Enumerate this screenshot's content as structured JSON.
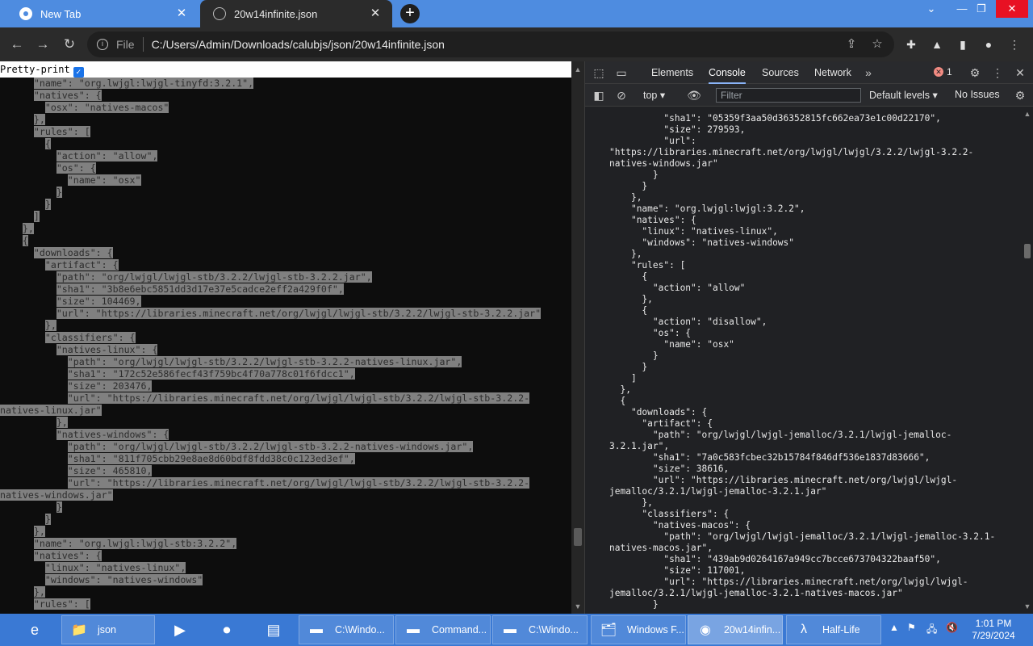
{
  "browser": {
    "tabs": [
      {
        "title": "New Tab"
      },
      {
        "title": "20w14infinite.json"
      }
    ],
    "new_tab_label": "+",
    "window_controls": {
      "minimize": "—",
      "maximize": "❐",
      "close": "✕"
    },
    "address": {
      "scheme": "File",
      "url": "C:/Users/Admin/Downloads/calubjs/json/20w14infinite.json"
    }
  },
  "viewer": {
    "pretty_print_label": "Pretty-print",
    "pretty_print_checked": true,
    "lines": [
      {
        "indent": "      ",
        "text": "\"name\": \"org.lwjgl:lwjgl-tinyfd:3.2.1\","
      },
      {
        "indent": "      ",
        "text": "\"natives\": {"
      },
      {
        "indent": "        ",
        "text": "\"osx\": \"natives-macos\""
      },
      {
        "indent": "      ",
        "text": "},"
      },
      {
        "indent": "      ",
        "text": "\"rules\": ["
      },
      {
        "indent": "        ",
        "text": "{"
      },
      {
        "indent": "          ",
        "text": "\"action\": \"allow\","
      },
      {
        "indent": "          ",
        "text": "\"os\": {"
      },
      {
        "indent": "            ",
        "text": "\"name\": \"osx\""
      },
      {
        "indent": "          ",
        "text": "}"
      },
      {
        "indent": "        ",
        "text": "}"
      },
      {
        "indent": "      ",
        "text": "]"
      },
      {
        "indent": "    ",
        "text": "},"
      },
      {
        "indent": "    ",
        "text": "{"
      },
      {
        "indent": "      ",
        "text": "\"downloads\": {"
      },
      {
        "indent": "        ",
        "text": "\"artifact\": {"
      },
      {
        "indent": "          ",
        "text": "\"path\": \"org/lwjgl/lwjgl-stb/3.2.2/lwjgl-stb-3.2.2.jar\","
      },
      {
        "indent": "          ",
        "text": "\"sha1\": \"3b8e6ebc5851dd3d17e37e5cadce2eff2a429f0f\","
      },
      {
        "indent": "          ",
        "text": "\"size\": 104469,"
      },
      {
        "indent": "          ",
        "text": "\"url\": \"https://libraries.minecraft.net/org/lwjgl/lwjgl-stb/3.2.2/lwjgl-stb-3.2.2.jar\""
      },
      {
        "indent": "        ",
        "text": "},"
      },
      {
        "indent": "        ",
        "text": "\"classifiers\": {"
      },
      {
        "indent": "          ",
        "text": "\"natives-linux\": {"
      },
      {
        "indent": "            ",
        "text": "\"path\": \"org/lwjgl/lwjgl-stb/3.2.2/lwjgl-stb-3.2.2-natives-linux.jar\","
      },
      {
        "indent": "            ",
        "text": "\"sha1\": \"172c52e586fecf43f759bc4f70a778c01f6fdcc1\","
      },
      {
        "indent": "            ",
        "text": "\"size\": 203476,"
      },
      {
        "indent": "            ",
        "text": "\"url\": \"https://libraries.minecraft.net/org/lwjgl/lwjgl-stb/3.2.2/lwjgl-stb-3.2.2-"
      },
      {
        "indent": "",
        "text": "natives-linux.jar\""
      },
      {
        "indent": "          ",
        "text": "},"
      },
      {
        "indent": "          ",
        "text": "\"natives-windows\": {"
      },
      {
        "indent": "            ",
        "text": "\"path\": \"org/lwjgl/lwjgl-stb/3.2.2/lwjgl-stb-3.2.2-natives-windows.jar\","
      },
      {
        "indent": "            ",
        "text": "\"sha1\": \"811f705cbb29e8ae8d60bdf8fdd38c0c123ed3ef\","
      },
      {
        "indent": "            ",
        "text": "\"size\": 465810,"
      },
      {
        "indent": "            ",
        "text": "\"url\": \"https://libraries.minecraft.net/org/lwjgl/lwjgl-stb/3.2.2/lwjgl-stb-3.2.2-"
      },
      {
        "indent": "",
        "text": "natives-windows.jar\""
      },
      {
        "indent": "          ",
        "text": "}"
      },
      {
        "indent": "        ",
        "text": "}"
      },
      {
        "indent": "      ",
        "text": "},"
      },
      {
        "indent": "      ",
        "text": "\"name\": \"org.lwjgl:lwjgl-stb:3.2.2\","
      },
      {
        "indent": "      ",
        "text": "\"natives\": {"
      },
      {
        "indent": "        ",
        "text": "\"linux\": \"natives-linux\","
      },
      {
        "indent": "        ",
        "text": "\"windows\": \"natives-windows\""
      },
      {
        "indent": "      ",
        "text": "},"
      },
      {
        "indent": "      ",
        "text": "\"rules\": ["
      }
    ]
  },
  "devtools": {
    "tabs": [
      "Elements",
      "Console",
      "Sources",
      "Network"
    ],
    "active_tab": "Console",
    "more_tabs": "»",
    "error_count": "1",
    "context": "top",
    "filter_placeholder": "Filter",
    "levels": "Default levels",
    "issues": "No Issues",
    "console_lines": [
      {
        "indent": "          ",
        "text": "\"sha1\": \"05359f3aa50d36352815fc662ea73e1c00d22170\","
      },
      {
        "indent": "          ",
        "text": "\"size\": 279593,"
      },
      {
        "indent": "          ",
        "text": "\"url\":"
      },
      {
        "indent": "",
        "text": "\"https://libraries.minecraft.net/org/lwjgl/lwjgl/3.2.2/lwjgl-3.2.2-"
      },
      {
        "indent": "",
        "text": "natives-windows.jar\""
      },
      {
        "indent": "        ",
        "text": "}"
      },
      {
        "indent": "      ",
        "text": "}"
      },
      {
        "indent": "    ",
        "text": "},"
      },
      {
        "indent": "    ",
        "text": "\"name\": \"org.lwjgl:lwjgl:3.2.2\","
      },
      {
        "indent": "    ",
        "text": "\"natives\": {"
      },
      {
        "indent": "      ",
        "text": "\"linux\": \"natives-linux\","
      },
      {
        "indent": "      ",
        "text": "\"windows\": \"natives-windows\""
      },
      {
        "indent": "    ",
        "text": "},"
      },
      {
        "indent": "    ",
        "text": "\"rules\": ["
      },
      {
        "indent": "      ",
        "text": "{"
      },
      {
        "indent": "        ",
        "text": "\"action\": \"allow\""
      },
      {
        "indent": "      ",
        "text": "},"
      },
      {
        "indent": "      ",
        "text": "{"
      },
      {
        "indent": "        ",
        "text": "\"action\": \"disallow\","
      },
      {
        "indent": "        ",
        "text": "\"os\": {"
      },
      {
        "indent": "          ",
        "text": "\"name\": \"osx\""
      },
      {
        "indent": "        ",
        "text": "}"
      },
      {
        "indent": "      ",
        "text": "}"
      },
      {
        "indent": "    ",
        "text": "]"
      },
      {
        "indent": "  ",
        "text": "},"
      },
      {
        "indent": "  ",
        "text": "{"
      },
      {
        "indent": "    ",
        "text": "\"downloads\": {"
      },
      {
        "indent": "      ",
        "text": "\"artifact\": {"
      },
      {
        "indent": "        ",
        "text": "\"path\": \"org/lwjgl/lwjgl-jemalloc/3.2.1/lwjgl-jemalloc-"
      },
      {
        "indent": "",
        "text": "3.2.1.jar\","
      },
      {
        "indent": "        ",
        "text": "\"sha1\": \"7a0c583fcbec32b15784f846df536e1837d83666\","
      },
      {
        "indent": "        ",
        "text": "\"size\": 38616,"
      },
      {
        "indent": "        ",
        "text": "\"url\": \"https://libraries.minecraft.net/org/lwjgl/lwjgl-"
      },
      {
        "indent": "",
        "text": "jemalloc/3.2.1/lwjgl-jemalloc-3.2.1.jar\""
      },
      {
        "indent": "      ",
        "text": "},"
      },
      {
        "indent": "      ",
        "text": "\"classifiers\": {"
      },
      {
        "indent": "        ",
        "text": "\"natives-macos\": {"
      },
      {
        "indent": "          ",
        "text": "\"path\": \"org/lwjgl/lwjgl-jemalloc/3.2.1/lwjgl-jemalloc-3.2.1-"
      },
      {
        "indent": "",
        "text": "natives-macos.jar\","
      },
      {
        "indent": "          ",
        "text": "\"sha1\": \"439ab9d0264167a949cc7bcce673704322baaf50\","
      },
      {
        "indent": "          ",
        "text": "\"size\": 117001,"
      },
      {
        "indent": "          ",
        "text": "\"url\": \"https://libraries.minecraft.net/org/lwjgl/lwjgl-"
      },
      {
        "indent": "",
        "text": "jemalloc/3.2.1/lwjgl-jemalloc-3.2.1-natives-macos.jar\""
      },
      {
        "indent": "        ",
        "text": "}"
      }
    ]
  },
  "taskbar": {
    "items": [
      {
        "label": "json",
        "icon": "folder-icon"
      },
      {
        "label": "C:\\Windo...",
        "icon": "cmd-icon"
      },
      {
        "label": "Command...",
        "icon": "cmd-icon"
      },
      {
        "label": "C:\\Windo...",
        "icon": "cmd-icon"
      },
      {
        "label": "Windows F...",
        "icon": "windows-explorer-icon"
      },
      {
        "label": "20w14infin...",
        "icon": "chrome-icon"
      },
      {
        "label": "Half-Life",
        "icon": "half-life-icon"
      }
    ],
    "clock_time": "1:01 PM",
    "clock_date": "7/29/2024"
  }
}
